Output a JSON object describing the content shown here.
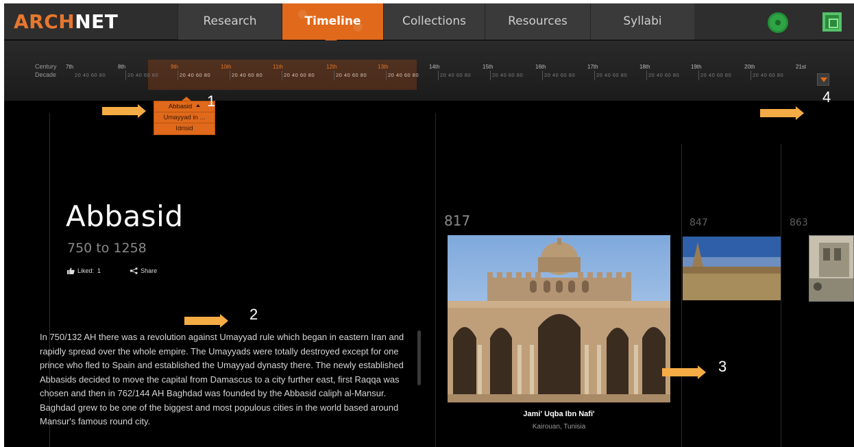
{
  "nav": {
    "logo_part1": "ARCH",
    "logo_part2": "NET",
    "tabs": [
      {
        "label": "Research"
      },
      {
        "label": "Timeline"
      },
      {
        "label": "Collections"
      },
      {
        "label": "Resources"
      },
      {
        "label": "Syllabi"
      }
    ],
    "active_tab": "Timeline",
    "accent_color": "#e0691b",
    "icons": [
      "flower-icon",
      "pattern-icon"
    ]
  },
  "timeline": {
    "century_label": "Century",
    "decade_label": "Decade",
    "centuries": [
      "7th",
      "8th",
      "9th",
      "10th",
      "11th",
      "12th",
      "13th",
      "14th",
      "15th",
      "16th",
      "17th",
      "18th",
      "19th",
      "20th",
      "21st"
    ],
    "highlighted_centuries": [
      "9th",
      "10th",
      "11th",
      "12th",
      "13th"
    ],
    "decade_ticks": "20 40 60 80"
  },
  "dynasty_dropdown": {
    "items": [
      {
        "label": "Abbasid"
      },
      {
        "label": "Umayyad in ..."
      },
      {
        "label": "Idrisid"
      }
    ]
  },
  "entry": {
    "title": "Abbasid",
    "date_range": "750 to 1258",
    "liked_label": "Liked:",
    "liked_count": "1",
    "share_label": "Share",
    "description": "In 750/132 AH there was a revolution against Umayyad rule which began in eastern Iran and rapidly spread over the whole empire. The Umayyads were totally destroyed except for one prince who fled to Spain and established the Umayyad dynasty there. The newly established Abbasids decided to move the capital from Damascus to a city further east, first Raqqa was chosen and then in 762/144 AH Baghdad was founded by the Abbasid caliph al-Mansur. Baghdad grew to be one of the biggest and most populous cities in the world based around Mansur's famous round city."
  },
  "works": [
    {
      "year": "817",
      "title": "Jami' Uqba Ibn Nafi'",
      "place": "Kairouan, Tunisia"
    },
    {
      "year": "847"
    },
    {
      "year": "863"
    }
  ],
  "annotations": [
    "1",
    "2",
    "3",
    "4"
  ],
  "annotation_color": "#f6ac45"
}
